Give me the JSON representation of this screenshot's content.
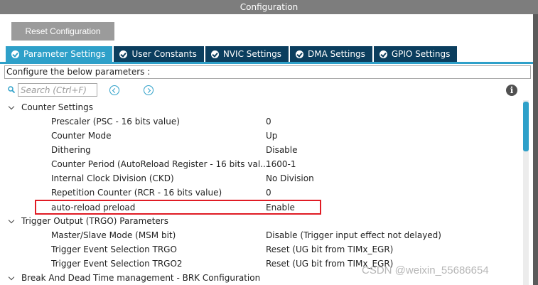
{
  "window": {
    "title": "Configuration"
  },
  "toolbar": {
    "reset_label": "Reset Configuration"
  },
  "tabs": [
    {
      "label": "Parameter Settings",
      "active": true
    },
    {
      "label": "User Constants",
      "active": false
    },
    {
      "label": "NVIC Settings",
      "active": false
    },
    {
      "label": "DMA Settings",
      "active": false
    },
    {
      "label": "GPIO Settings",
      "active": false
    }
  ],
  "configure_text": "Configure the below parameters :",
  "search": {
    "placeholder": "Search (Ctrl+F)"
  },
  "groups": [
    {
      "label": "Counter Settings"
    },
    {
      "label": "Trigger Output (TRGO) Parameters"
    },
    {
      "label": "Break And Dead Time management - BRK Configuration"
    }
  ],
  "params": [
    {
      "label": "Prescaler (PSC - 16 bits value)",
      "value": "0"
    },
    {
      "label": "Counter Mode",
      "value": "Up"
    },
    {
      "label": "Dithering",
      "value": "Disable"
    },
    {
      "label": "Counter Period (AutoReload Register - 16 bits val...",
      "value": "1600-1"
    },
    {
      "label": "Internal Clock Division (CKD)",
      "value": "No Division"
    },
    {
      "label": "Repetition Counter (RCR - 16 bits value)",
      "value": "0"
    },
    {
      "label": "auto-reload preload",
      "value": "Enable"
    },
    {
      "label": "Master/Slave Mode (MSM bit)",
      "value": "Disable (Trigger input effect not delayed)"
    },
    {
      "label": "Trigger Event Selection TRGO",
      "value": "Reset (UG bit from TIMx_EGR)"
    },
    {
      "label": "Trigger Event Selection TRGO2",
      "value": "Reset (UG bit from TIMx_EGR)"
    }
  ],
  "watermark": "CSDN @weixin_55686654",
  "colors": {
    "accent": "#2ea0c9",
    "tab_dark": "#0b3e5e",
    "highlight": "#e01b24"
  }
}
